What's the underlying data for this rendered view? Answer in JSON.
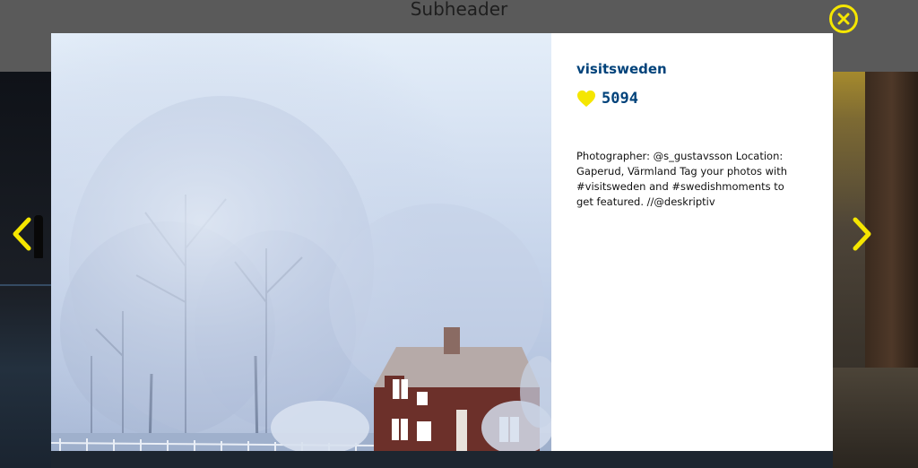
{
  "page": {
    "subheader": "Subheader"
  },
  "modal": {
    "username": "visitsweden",
    "likes": "5094",
    "caption": "Photographer: @s_gustavsson Location: Gaperud, Värmland Tag your photos with #visitsweden and #swedishmoments to get featured. //@deskriptiv",
    "photo_description_icon": "landscape-photo"
  },
  "controls": {
    "prev_icon": "chevron-left-icon",
    "next_icon": "chevron-right-icon",
    "close_icon": "close-icon"
  },
  "colors": {
    "accent": "#f5e600",
    "brand": "#00427a"
  }
}
